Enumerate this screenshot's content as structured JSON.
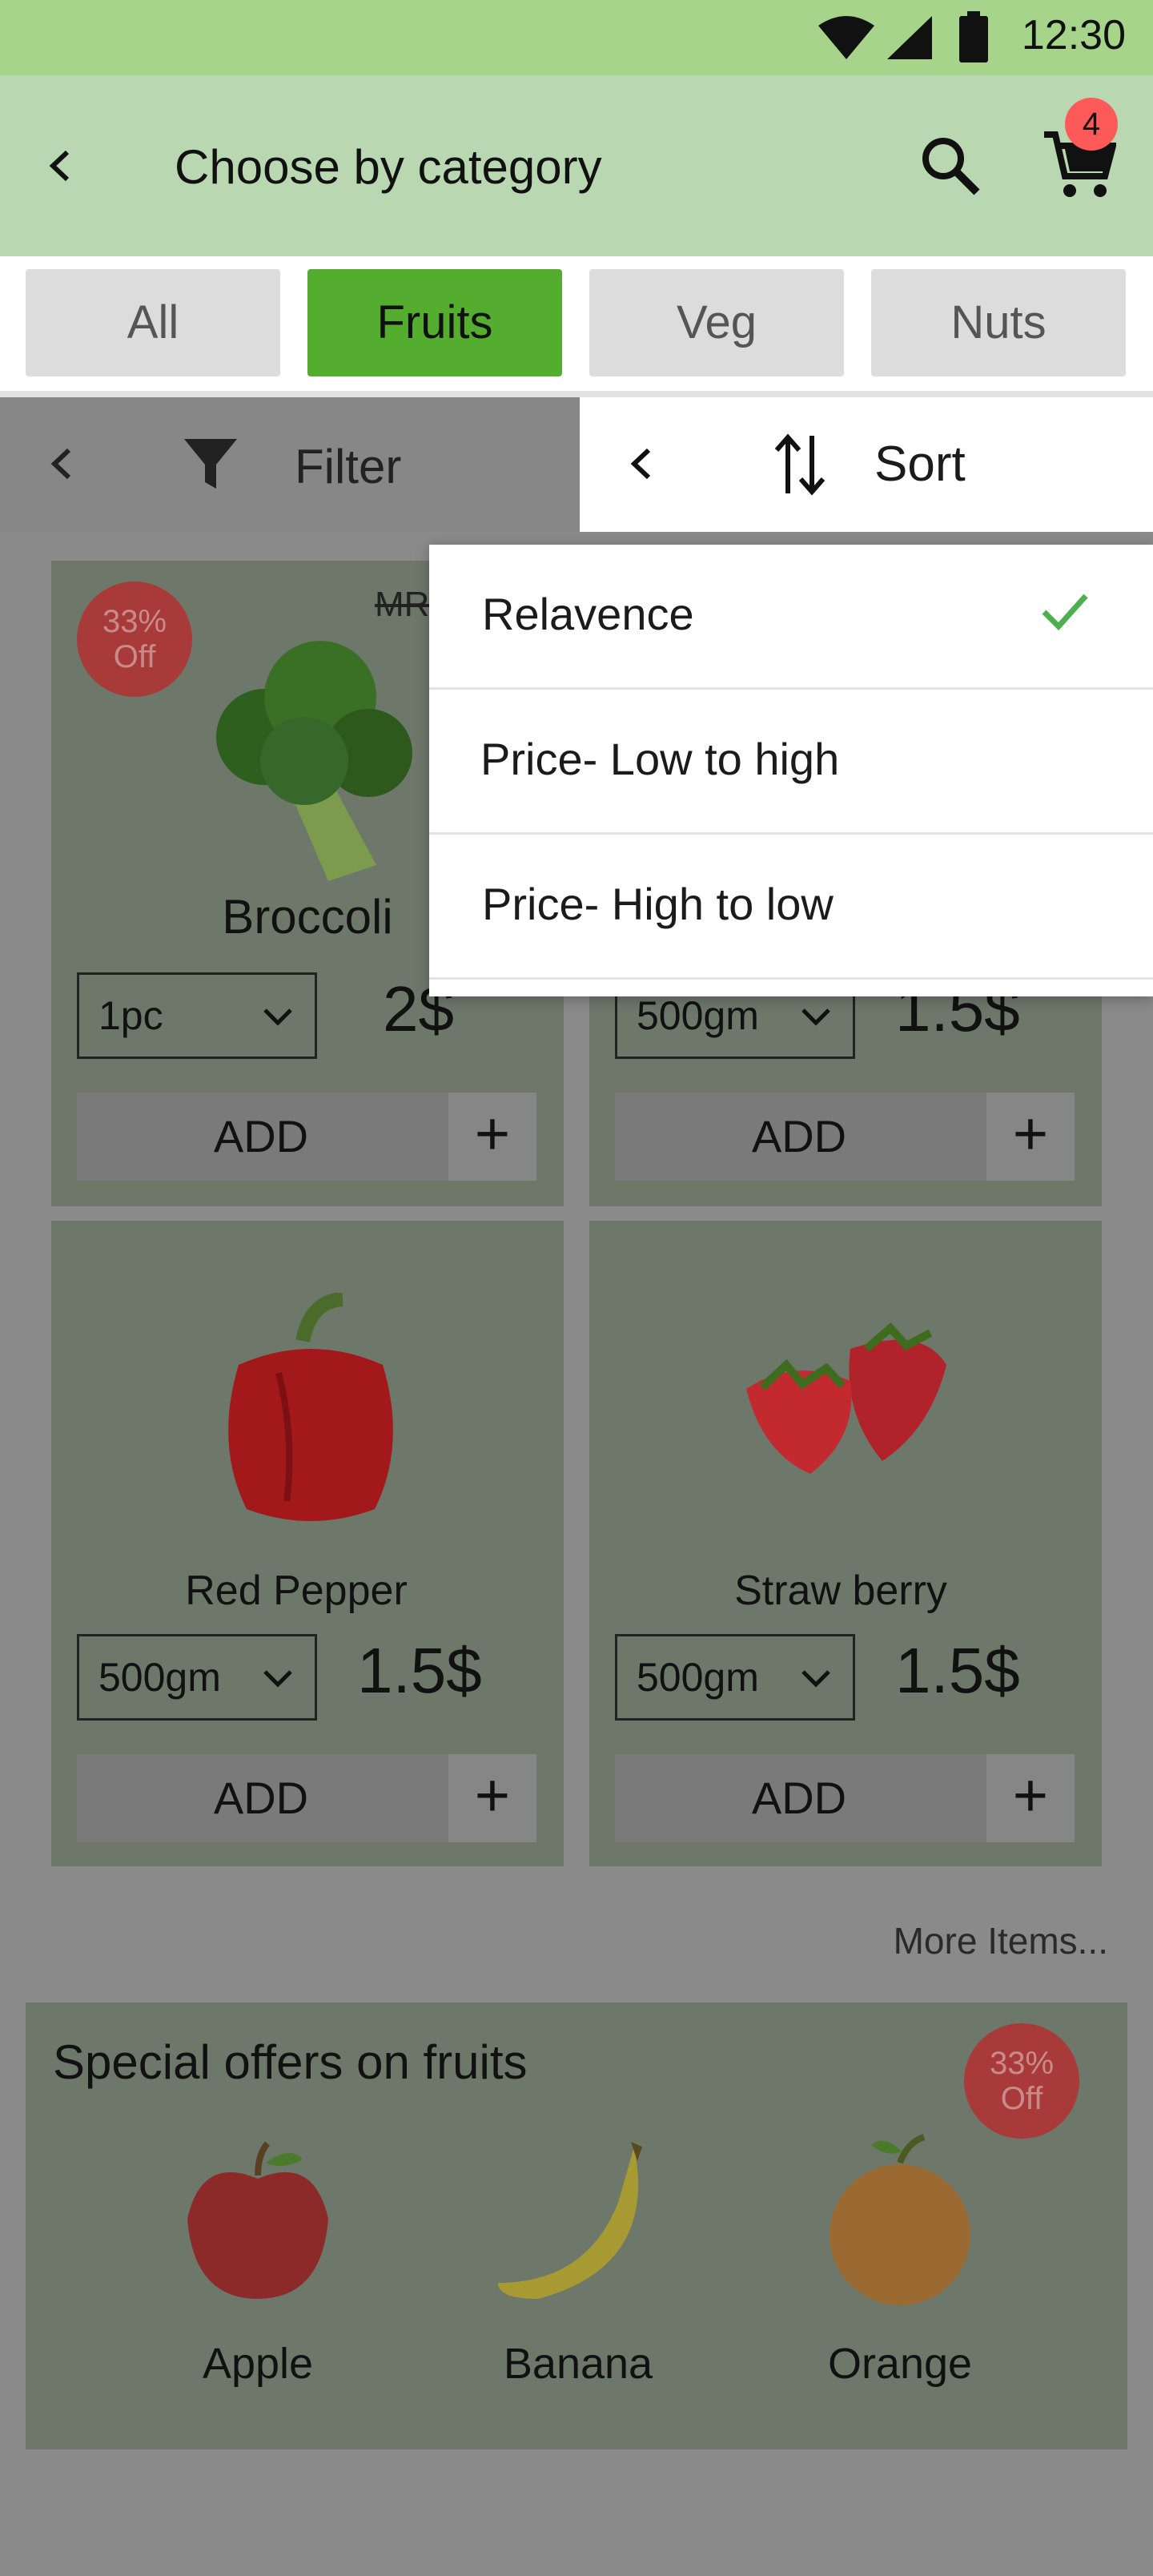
{
  "status_bar": {
    "time": "12:30"
  },
  "header": {
    "title": "Choose by category",
    "cart_count": "4"
  },
  "tabs": [
    {
      "label": "All",
      "active": false
    },
    {
      "label": "Fruits",
      "active": true
    },
    {
      "label": "Veg",
      "active": false
    },
    {
      "label": "Nuts",
      "active": false
    }
  ],
  "filter": {
    "label": "Filter"
  },
  "sort": {
    "label": "Sort",
    "options": [
      {
        "label": "Relavence",
        "selected": true
      },
      {
        "label": "Price- Low to high",
        "selected": false
      },
      {
        "label": "Price- High to low",
        "selected": false
      }
    ]
  },
  "products": [
    {
      "name": "Broccoli",
      "quantity": "1pc",
      "price": "2$",
      "discount_pct": "33%",
      "discount_word": "Off",
      "mrp_label": "MR",
      "add_label": "ADD"
    },
    {
      "name": "",
      "quantity": "500gm",
      "price": "1.5$",
      "add_label": "ADD"
    },
    {
      "name": "Red Pepper",
      "quantity": "500gm",
      "price": "1.5$",
      "add_label": "ADD"
    },
    {
      "name": "Straw berry",
      "quantity": "500gm",
      "price": "1.5$",
      "add_label": "ADD"
    }
  ],
  "more_items": "More Items...",
  "offers": {
    "title": "Special offers on fruits",
    "discount_pct": "33%",
    "discount_word": "Off",
    "items": [
      {
        "name": "Apple"
      },
      {
        "name": "Banana"
      },
      {
        "name": "Orange"
      }
    ]
  },
  "colors": {
    "accent": "#55ad2f",
    "header_bg": "#b9d8b2",
    "status_bg": "#a6d48a",
    "check": "#4caf50",
    "badge": "#ff5a5a"
  }
}
